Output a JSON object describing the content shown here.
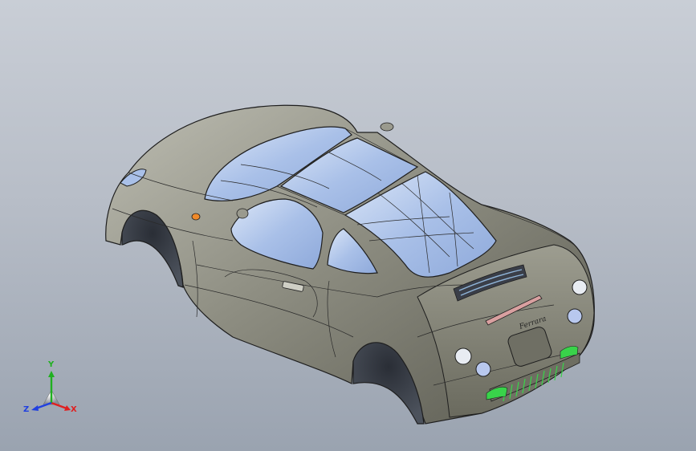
{
  "viewport": {
    "background_top": "#c9ced6",
    "background_bottom": "#9aa3b0",
    "model": {
      "name": "car-body-shell",
      "body_color": "#8a8a7c",
      "glass_color": "#a9c0e8",
      "edge_color": "#1e1e1e",
      "accent_green": "#39d34a",
      "indicator_orange": "#f08a2a",
      "brand_script": "Ferrara"
    },
    "triad": {
      "x_label": "X",
      "y_label": "Y",
      "z_label": "Z",
      "x_color": "#e02020",
      "y_color": "#20b020",
      "z_color": "#2040e0"
    }
  }
}
